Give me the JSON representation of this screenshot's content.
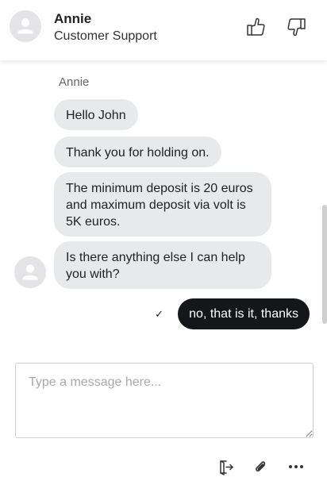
{
  "header": {
    "agent_name": "Annie",
    "agent_role": "Customer Support"
  },
  "chat": {
    "sender_label": "Annie",
    "agent_messages": [
      "Hello John",
      "Thank you for holding on.",
      "The minimum deposit is 20 euros and maximum deposit via volt is 5K euros.",
      "Is there anything else I can help you with?"
    ],
    "user_message": "no, that is it, thanks",
    "delivered_mark": "✓"
  },
  "composer": {
    "placeholder": "Type a message here..."
  },
  "colors": {
    "agent_bubble": "#e8e9eb",
    "user_bubble": "#141619",
    "avatar_bg": "#e4e4e6"
  },
  "icons": [
    "user-avatar-icon",
    "thumbs-up-icon",
    "thumbs-down-icon",
    "checkmark-icon",
    "end-chat-icon",
    "paperclip-icon",
    "more-icon"
  ]
}
